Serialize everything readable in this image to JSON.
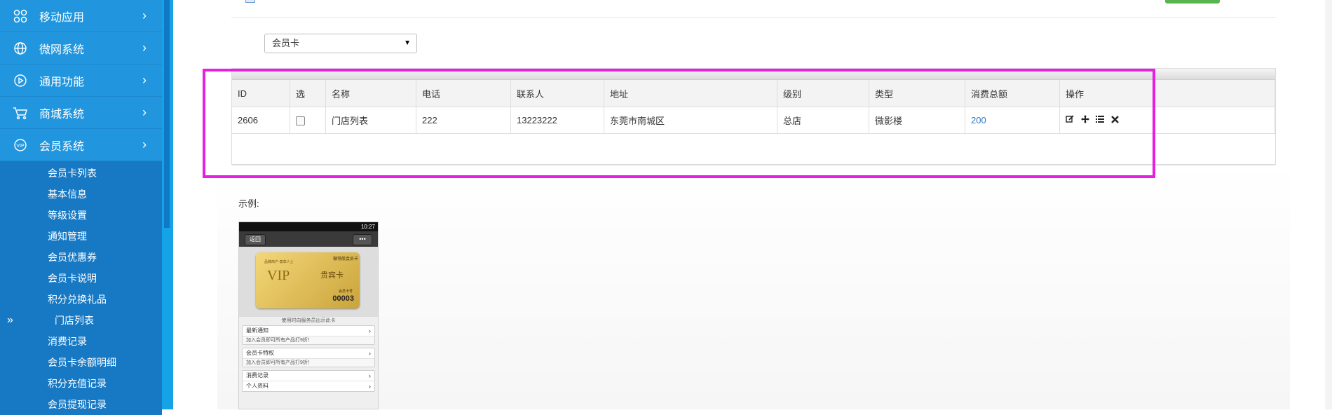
{
  "sidebar": {
    "menu": [
      {
        "label": "移动应用",
        "icon": "apps-icon"
      },
      {
        "label": "微网系统",
        "icon": "globe-icon"
      },
      {
        "label": "通用功能",
        "icon": "play-circle-icon"
      },
      {
        "label": "商城系统",
        "icon": "cart-icon"
      },
      {
        "label": "会员系统",
        "icon": "vip-icon"
      }
    ],
    "chevron": "›",
    "collapse_glyph": "»",
    "submenu": [
      "会员卡列表",
      "基本信息",
      "等级设置",
      "通知管理",
      "会员优惠券",
      "会员卡说明",
      "积分兑换礼品",
      "门店列表",
      "消费记录",
      "会员卡余额明细",
      "积分充值记录",
      "会员提现记录"
    ]
  },
  "filter": {
    "selected": "会员卡",
    "caret": "▼"
  },
  "table": {
    "headers": [
      "ID",
      "选",
      "名称",
      "电话",
      "联系人",
      "地址",
      "级别",
      "类型",
      "消费总额",
      "操作"
    ],
    "rows": [
      {
        "id": "2606",
        "name": "门店列表",
        "phone": "222",
        "contact": "13223222",
        "address": "东莞市南城区",
        "level": "总店",
        "type": "微影楼",
        "total": "200",
        "ops": [
          "edit-icon",
          "move-icon",
          "list-icon",
          "delete-icon"
        ]
      }
    ]
  },
  "example": {
    "label": "示例:",
    "phone": {
      "time": "10:27",
      "back": "返回",
      "more": "•••",
      "card_title": "贵宾卡",
      "card_top": "微导航会员卡",
      "card_sub": "品牌商户·尊享人士",
      "card_vip": "VIP",
      "card_no_label": "会员卡号",
      "card_no": "00003",
      "hint": "使用时向服务员出示此卡",
      "rows": [
        {
          "title": "最新通知",
          "desc": "加入会员即可所有产品打9折！"
        },
        {
          "title": "会员卡特权",
          "desc": "加入会员即可所有产品打9折！"
        },
        {
          "title": "消费记录",
          "desc": ""
        },
        {
          "title": "个人资料",
          "desc": ""
        }
      ],
      "gt": "›"
    }
  },
  "colors": {
    "sidebar": "#2196de",
    "submenu": "#1779c4",
    "highlight": "#e81ee3",
    "link": "#2a7ac7",
    "green_button": "#58b54f"
  }
}
